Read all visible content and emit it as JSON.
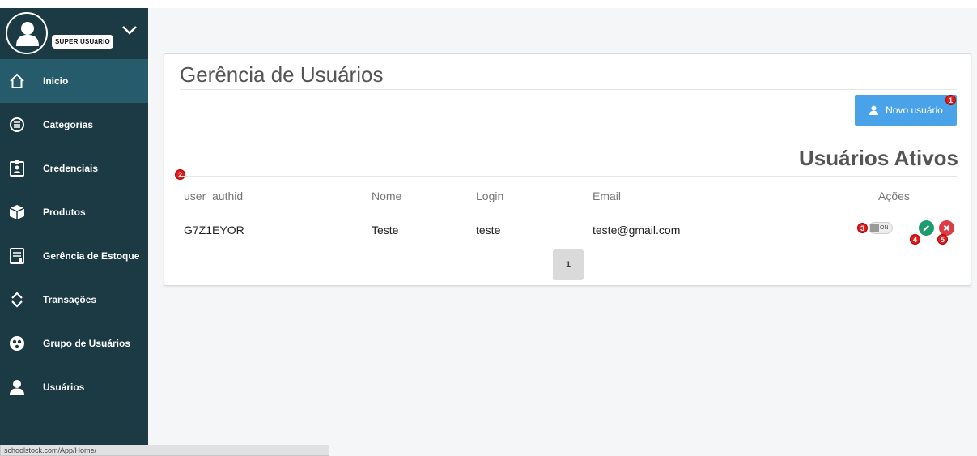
{
  "sidebar": {
    "profile": {
      "role_badge": "SUPER USUáRIO"
    },
    "items": [
      {
        "label": "Inicio",
        "icon": "home-icon",
        "active": true
      },
      {
        "label": "Categorias",
        "icon": "list-circle-icon",
        "active": false
      },
      {
        "label": "Credenciais",
        "icon": "id-badge-icon",
        "active": false
      },
      {
        "label": "Produtos",
        "icon": "box-icon",
        "active": false
      },
      {
        "label": "Gerência de Estoque",
        "icon": "register-icon",
        "active": false
      },
      {
        "label": "Transações",
        "icon": "sort-arrows-icon",
        "active": false
      },
      {
        "label": "Grupo de Usuários",
        "icon": "group-icon",
        "active": false
      },
      {
        "label": "Usuários",
        "icon": "user-icon",
        "active": false
      }
    ]
  },
  "status_bar": {
    "url": "schoolstock.com/App/Home/"
  },
  "page": {
    "title": "Gerência de Usuários",
    "new_user_label": "Novo usuário",
    "subtitle": "Usuários Ativos"
  },
  "table": {
    "headers": [
      "user_authid",
      "Nome",
      "Login",
      "Email",
      "Ações"
    ],
    "rows": [
      {
        "user_authid": "G7Z1EYOR",
        "nome": "Teste",
        "login": "teste",
        "email": "teste@gmail.com",
        "status_toggle": "ON"
      }
    ]
  },
  "pagination": {
    "current": "1"
  },
  "markers": [
    "1",
    "2",
    "3",
    "4",
    "5"
  ],
  "colors": {
    "sidebar_bg": "#1c3a44",
    "sidebar_active": "#265b6c",
    "primary_button": "#4aa3e8",
    "edit_button": "#1f9c6d",
    "delete_button": "#dc3b42",
    "marker": "#e21b1b"
  }
}
